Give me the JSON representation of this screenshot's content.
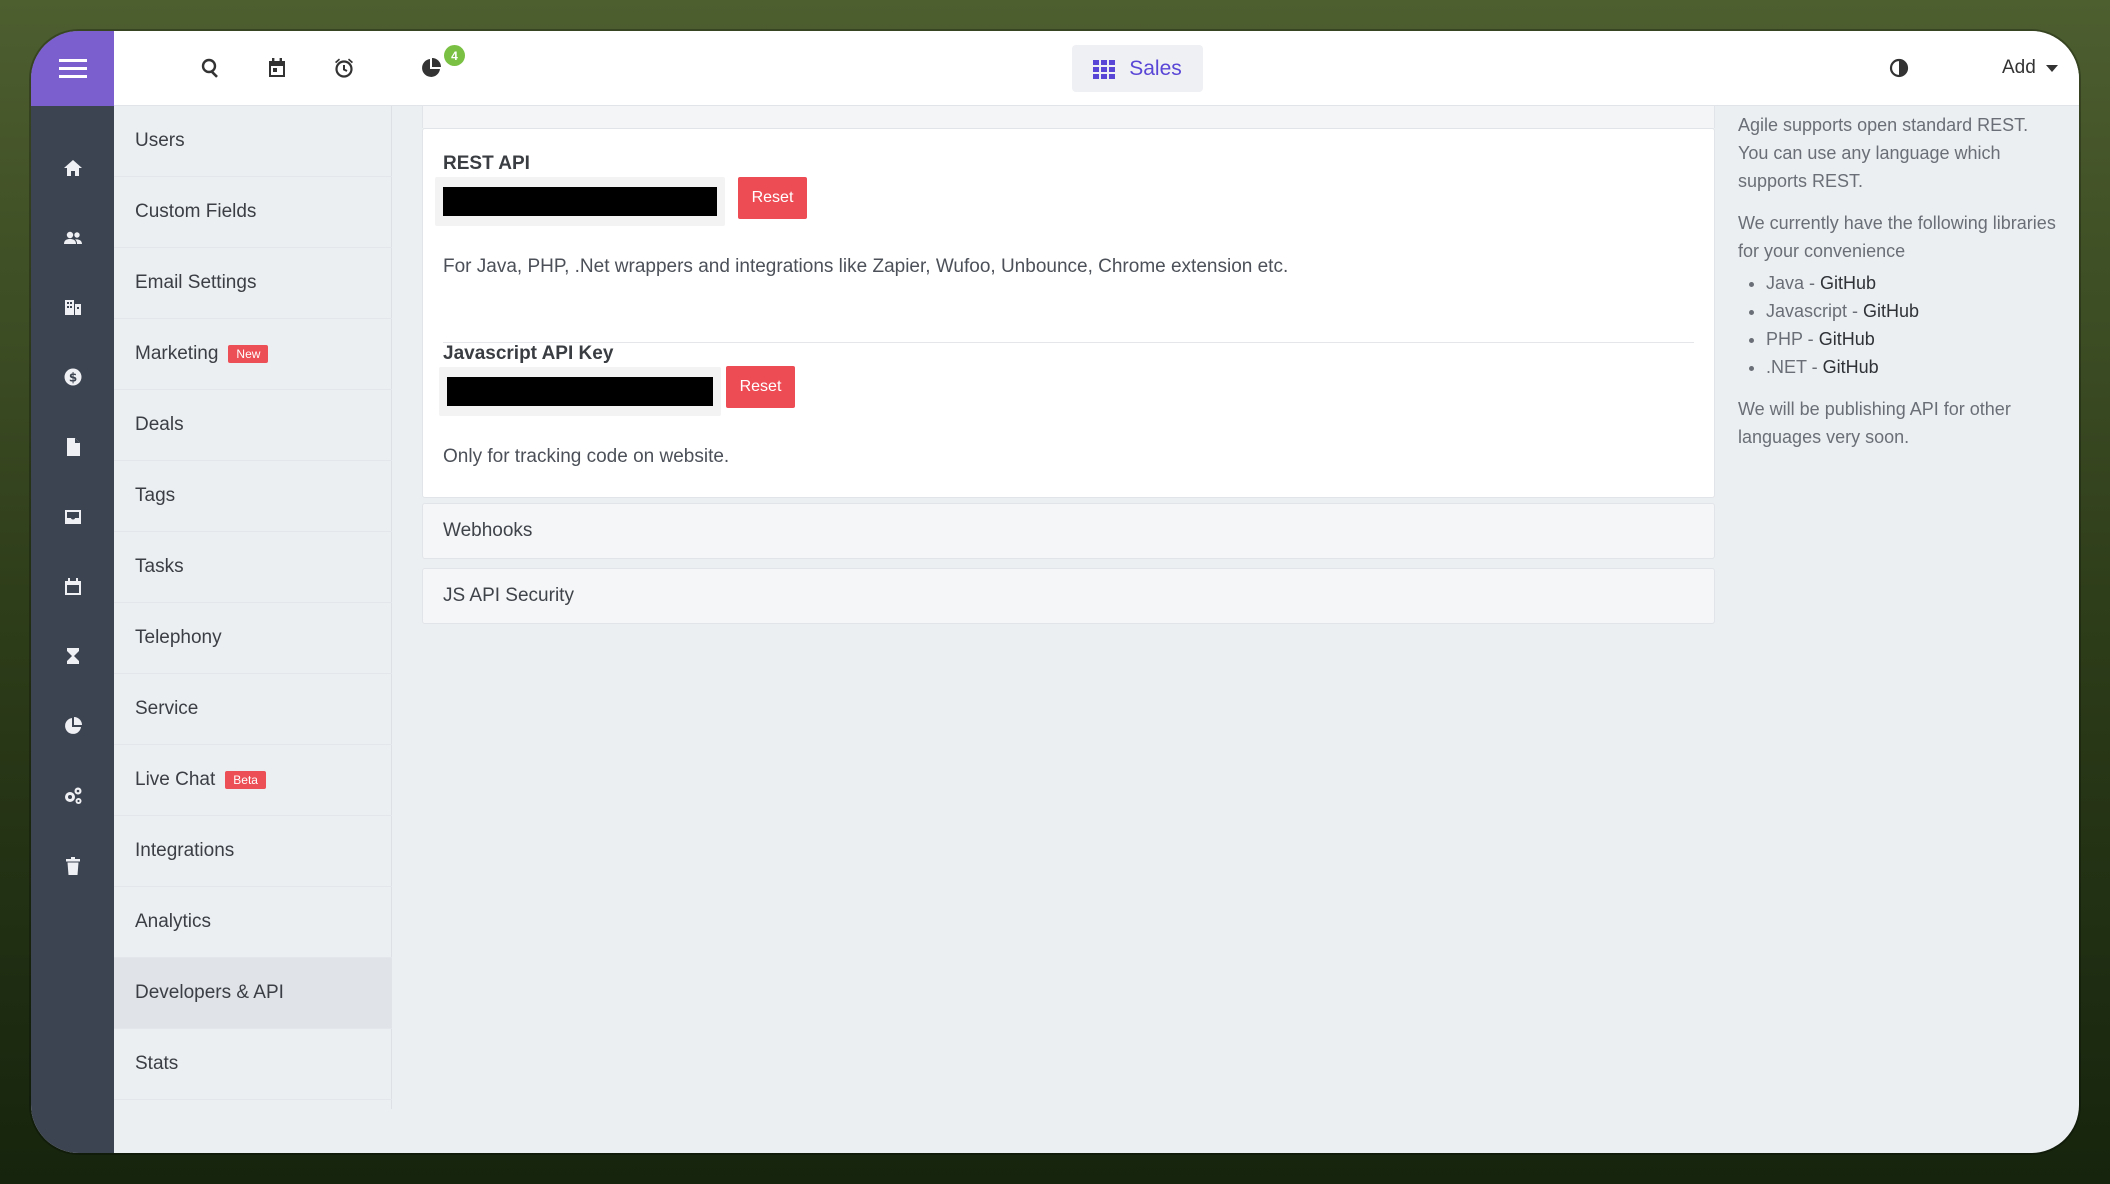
{
  "header": {
    "notification_count": "4",
    "module_label": "Sales",
    "add_label": "Add"
  },
  "rail": {
    "icons": [
      "menu-icon",
      "home-icon",
      "contacts-icon",
      "companies-icon",
      "deals-icon",
      "documents-icon",
      "inbox-icon",
      "calendar-icon",
      "tasks-icon",
      "reports-icon",
      "settings-icon",
      "trash-icon"
    ]
  },
  "sidebar": {
    "items": [
      {
        "label": "Users"
      },
      {
        "label": "Custom Fields"
      },
      {
        "label": "Email Settings"
      },
      {
        "label": "Marketing",
        "badge": "New"
      },
      {
        "label": "Deals"
      },
      {
        "label": "Tags"
      },
      {
        "label": "Tasks"
      },
      {
        "label": "Telephony"
      },
      {
        "label": "Service"
      },
      {
        "label": "Live Chat",
        "badge": "Beta"
      },
      {
        "label": "Integrations"
      },
      {
        "label": "Analytics"
      },
      {
        "label": "Developers & API",
        "active": true
      },
      {
        "label": "Stats"
      }
    ]
  },
  "main": {
    "rest_api": {
      "label": "REST API",
      "reset_label": "Reset",
      "description": "For Java, PHP, .Net wrappers and integrations like Zapier, Wufoo, Unbounce, Chrome extension etc."
    },
    "js_api": {
      "label": "Javascript API Key",
      "reset_label": "Reset",
      "description": "Only for tracking code on website."
    },
    "panels": [
      "Webhooks",
      "JS API Security"
    ]
  },
  "help": {
    "intro": "Agile supports open standard REST. You can use any language which supports REST.",
    "libraries_intro": "We currently have the following libraries for your convenience",
    "libraries": [
      {
        "lang": "Java - ",
        "link": "GitHub"
      },
      {
        "lang": "Javascript - ",
        "link": "GitHub"
      },
      {
        "lang": "PHP - ",
        "link": "GitHub"
      },
      {
        "lang": ".NET - ",
        "link": "GitHub"
      }
    ],
    "outro": "We will be publishing API for other languages very soon."
  },
  "colors": {
    "rail": "#3d4451",
    "rail_top": "#7b5fcf",
    "accent": "#5a46d6",
    "danger": "#ee4c55",
    "badge_green": "#7ac143"
  }
}
